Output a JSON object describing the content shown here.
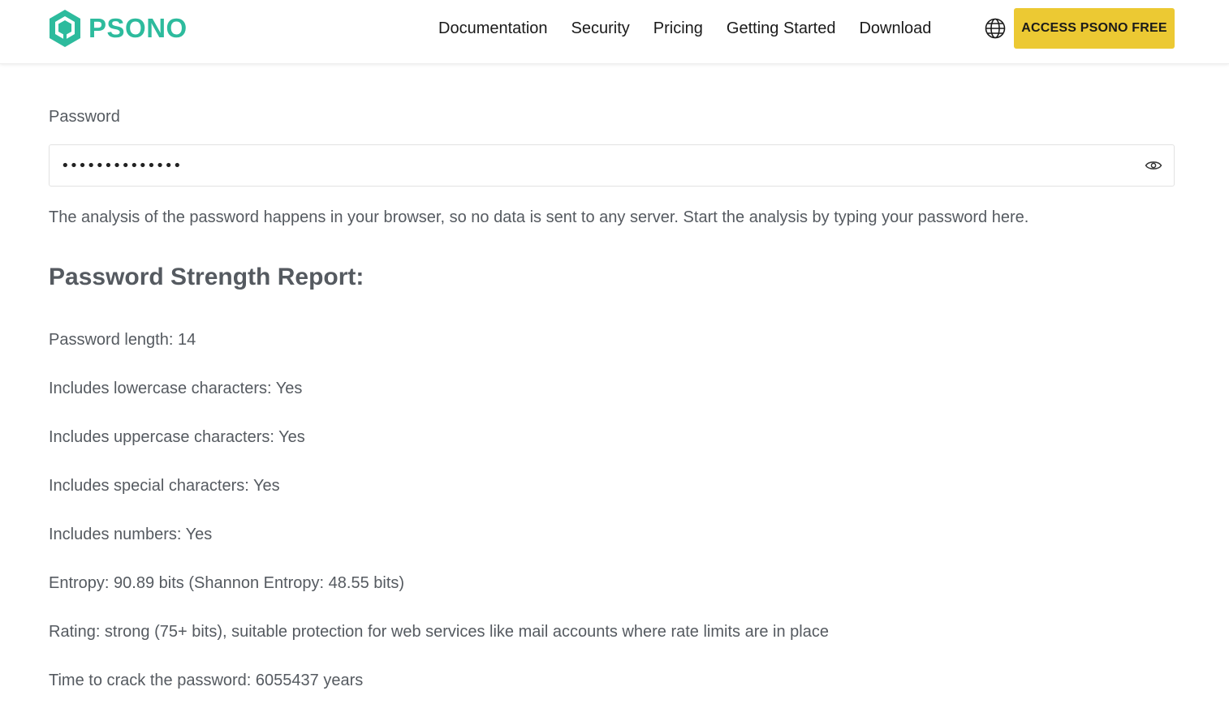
{
  "header": {
    "logo_text": "PSONO",
    "nav": [
      "Documentation",
      "Security",
      "Pricing",
      "Getting Started",
      "Download"
    ],
    "language_icon": "globe-icon",
    "cta_label": "ACCESS PSONO FREE"
  },
  "colors": {
    "brand": "#2dbb9d",
    "cta": "#ecc933",
    "text": "#555a60"
  },
  "form": {
    "label": "Password",
    "value": "••••••••••••••",
    "toggle_icon": "eye-icon",
    "hint": "The analysis of the password happens in your browser, so no data is sent to any server. Start the analysis by typing your password here."
  },
  "report": {
    "title": "Password Strength Report:",
    "lines": [
      "Password length: 14",
      "Includes lowercase characters: Yes",
      "Includes uppercase characters: Yes",
      "Includes special characters: Yes",
      "Includes numbers: Yes",
      "Entropy: 90.89 bits (Shannon Entropy: 48.55 bits)",
      "Rating: strong (75+ bits), suitable protection for web services like mail accounts where rate limits are in place",
      "Time to crack the password: 6055437 years"
    ]
  }
}
